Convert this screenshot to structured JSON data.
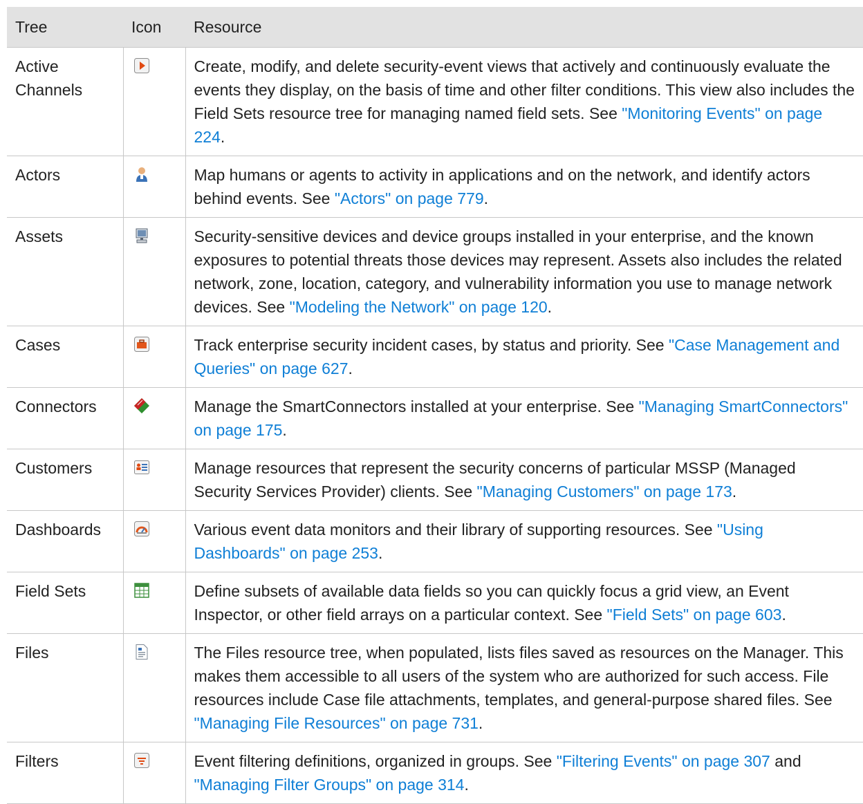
{
  "headers": {
    "tree": "Tree",
    "icon": "Icon",
    "resource": "Resource"
  },
  "rows": [
    {
      "tree": "Active Channels",
      "icon": "active-channel-play-icon",
      "text": "Create, modify, and delete security-event views that actively and continuously evaluate the events they display, on the basis of time and other filter conditions. This view also includes the Field Sets resource tree for managing named field sets. See ",
      "link": "\"Monitoring Events\" on page 224",
      "after": "."
    },
    {
      "tree": "Actors",
      "icon": "actor-person-icon",
      "text": "Map humans or agents to activity in applications and on the network, and identify actors behind events. See ",
      "link": "\"Actors\" on page 779",
      "after": "."
    },
    {
      "tree": "Assets",
      "icon": "asset-computer-icon",
      "text": "Security-sensitive devices and device groups installed in your enterprise, and the known exposures to potential threats those devices may represent. Assets also includes the related network, zone, location, category, and vulnerability information you use to manage network devices. See ",
      "link": "\"Modeling the Network\" on page 120",
      "after": "."
    },
    {
      "tree": "Cases",
      "icon": "case-briefcase-icon",
      "text": "Track enterprise security incident cases, by status and priority. See ",
      "link": "\"Case Management and Queries\" on page 627",
      "after": "."
    },
    {
      "tree": "Connectors",
      "icon": "connector-icon",
      "text": "Manage the SmartConnectors installed at your enterprise. See ",
      "link": "\"Managing SmartConnectors\" on page 175",
      "after": "."
    },
    {
      "tree": "Customers",
      "icon": "customer-card-icon",
      "text": "Manage resources that represent the security concerns of particular MSSP (Managed Security Services Provider) clients. See ",
      "link": "\"Managing Customers\" on page 173",
      "after": "."
    },
    {
      "tree": "Dashboards",
      "icon": "dashboard-gauge-icon",
      "text": "Various event data monitors and their library of supporting resources. See ",
      "link": "\"Using Dashboards\" on page 253",
      "after": "."
    },
    {
      "tree": "Field Sets",
      "icon": "field-set-grid-icon",
      "text": "Define subsets of available data fields so you can quickly focus a grid view, an Event Inspector, or other field arrays on a particular context. See ",
      "link": "\"Field Sets\" on page 603",
      "after": "."
    },
    {
      "tree": "Files",
      "icon": "file-document-icon",
      "text": "The Files resource tree, when populated, lists files saved as resources on the Manager. This makes them accessible to all users of the system who are authorized for such access. File resources include Case file attachments, templates, and general-purpose shared files. See ",
      "link": "\"Managing File Resources\" on page 731",
      "after": "."
    },
    {
      "tree": "Filters",
      "icon": "filter-icon",
      "text": "Event filtering definitions, organized in groups. See ",
      "link": "\"Filtering Events\" on page 307",
      "mid": " and ",
      "link2": "\"Managing Filter Groups\" on page 314",
      "after": "."
    }
  ]
}
